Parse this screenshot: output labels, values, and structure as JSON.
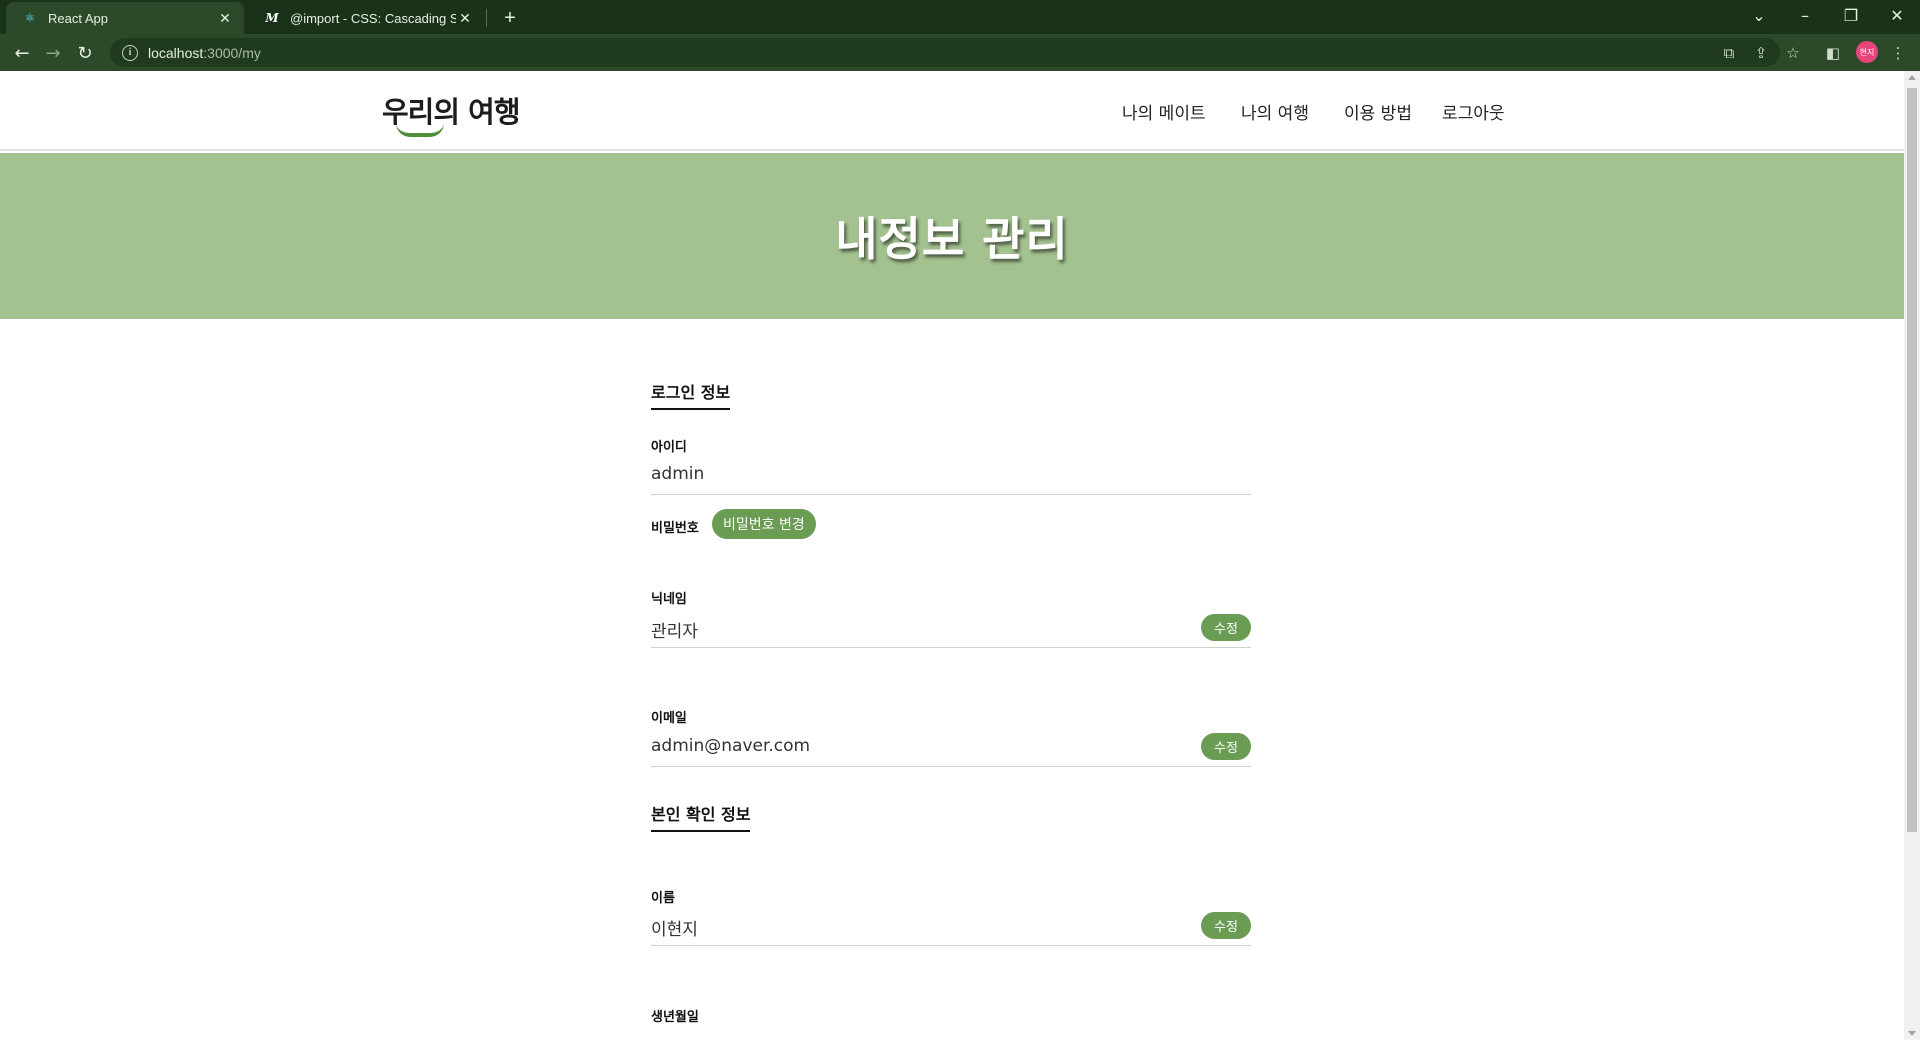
{
  "browser": {
    "tabs": [
      {
        "title": "React App",
        "favicon": "react-icon",
        "active": true
      },
      {
        "title": "@import - CSS: Cascading Style",
        "favicon": "mdn-icon",
        "active": false
      }
    ],
    "url_host": "localhost",
    "url_path": ":3000/my",
    "profile_initials": "현지",
    "colors": {
      "frame": "#1a3318",
      "toolbar": "#2c4a29",
      "omnibox": "#1f3a1d"
    }
  },
  "header": {
    "logo_text": "우리의 여행",
    "nav": [
      "나의 메이트",
      "나의 여행",
      "이용 방법",
      "로그아웃"
    ]
  },
  "hero": {
    "title": "내정보 관리",
    "background": "#a3c28f"
  },
  "login_section": {
    "title": "로그인 정보",
    "id_label": "아이디",
    "id_value": "admin",
    "password_label": "비밀번호",
    "password_change_label": "비밀번호 변경",
    "nickname_label": "닉네임",
    "nickname_value": "관리자",
    "email_label": "이메일",
    "email_value": "admin@naver.com",
    "edit_label": "수정"
  },
  "identity_section": {
    "title": "본인 확인 정보",
    "name_label": "이름",
    "name_value": "이현지",
    "birthday_label": "생년월일",
    "edit_label": "수정"
  },
  "accent_color": "#6a9c54"
}
